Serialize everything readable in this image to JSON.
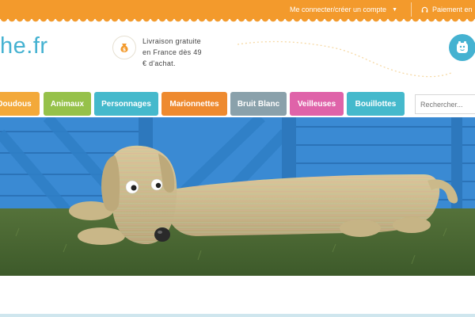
{
  "topbar": {
    "account_label": "Me connecter/créer un compte",
    "payment_label": "Paiement en"
  },
  "header": {
    "logo_text": "he.fr",
    "delivery_text": "Livraison gratuite en France dès 49 € d'achat."
  },
  "nav": {
    "items": [
      {
        "label": "Doudous",
        "color": "#f3a93a"
      },
      {
        "label": "Animaux",
        "color": "#96c14a"
      },
      {
        "label": "Personnages",
        "color": "#45b9cc"
      },
      {
        "label": "Marionnettes",
        "color": "#ee8a2f"
      },
      {
        "label": "Bruit Blanc",
        "color": "#8aa1ab"
      },
      {
        "label": "Veilleuses",
        "color": "#df63a9"
      },
      {
        "label": "Bouillottes",
        "color": "#45b9cc"
      }
    ],
    "search_placeholder": "Rechercher..."
  },
  "icons": {
    "account_caret": "chevron-down-icon",
    "payment": "headset-icon",
    "delivery": "money-bag-icon",
    "mascot": "mascot-icon"
  },
  "colors": {
    "brand_orange": "#f39a2c",
    "brand_blue": "#45b2d1"
  }
}
